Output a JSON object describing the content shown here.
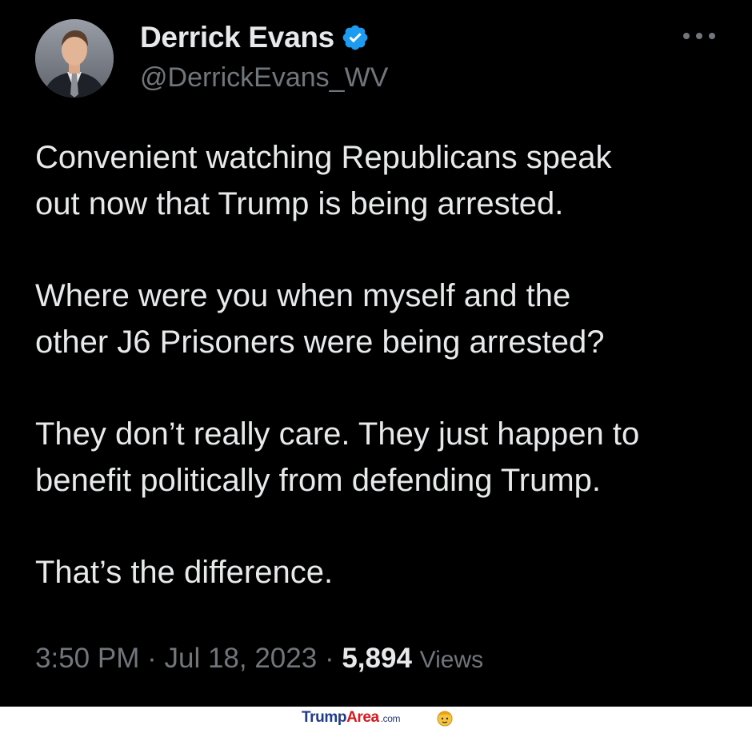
{
  "author": {
    "display_name": "Derrick Evans",
    "handle": "@DerrickEvans_WV",
    "avatar_icon": "user-avatar-photo",
    "verified_icon": "verified-badge-icon"
  },
  "more_icon": "more-options-icon",
  "tweet": {
    "paragraphs": [
      {
        "lines": [
          "Convenient watching Republicans speak",
          "out now that Trump is being arrested."
        ]
      },
      {
        "lines": [
          "Where were you when myself and the",
          "other J6 Prisoners were being arrested?"
        ]
      },
      {
        "lines": [
          "They don’t really care. They just happen to",
          "benefit politically from defending Trump."
        ]
      },
      {
        "lines": [
          "That’s the difference."
        ]
      }
    ]
  },
  "meta": {
    "time": "3:50 PM",
    "separator": "·",
    "date": "Jul 18, 2023",
    "views_count": "5,894",
    "views_label": "Views"
  },
  "watermark": {
    "brand_part1": "Trump",
    "brand_part2": "Area",
    "brand_suffix": ".com"
  },
  "colors": {
    "background": "#000000",
    "text_primary": "#e7e9ea",
    "text_secondary": "#71767b",
    "verified_blue": "#1d9bf0"
  }
}
